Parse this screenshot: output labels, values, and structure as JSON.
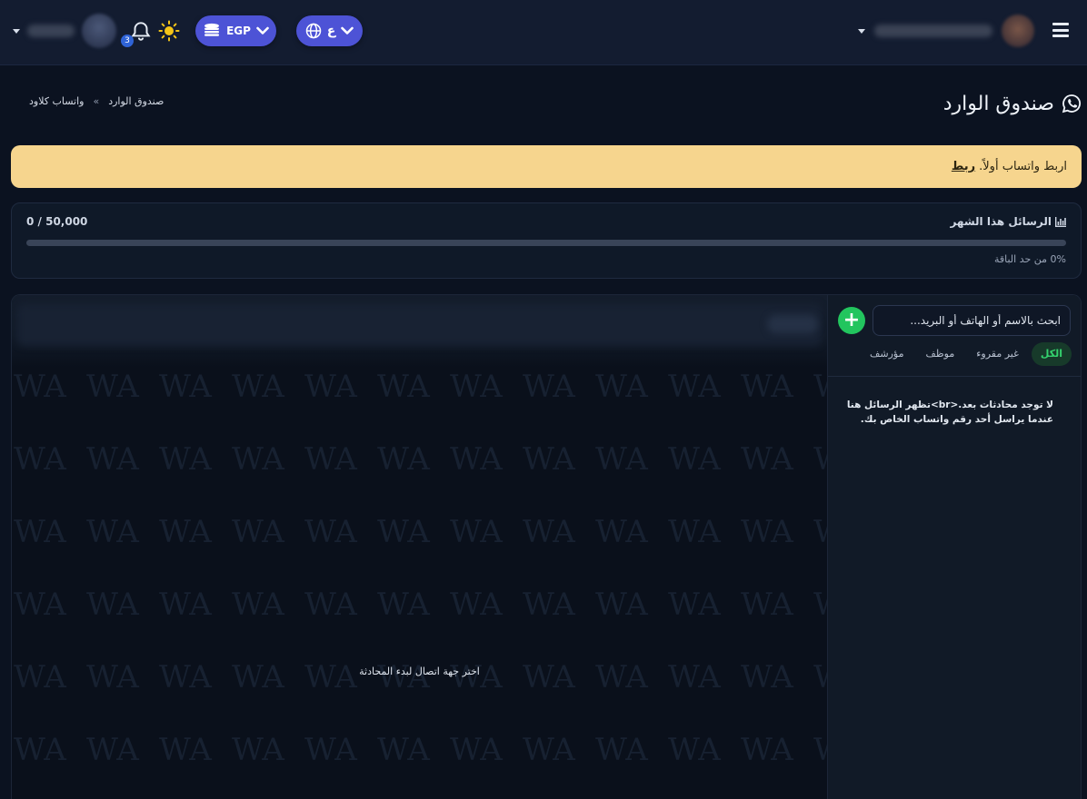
{
  "topbar": {
    "notifications_count": "3",
    "currency_label": "EGP",
    "language_label": "ع",
    "icons": {
      "user_menu_caret": "caret-down-icon",
      "notifications": "bell-icon",
      "theme_toggle": "sun-icon",
      "currency": "coins-icon",
      "language": "globe-icon",
      "menu": "hamburger-icon"
    },
    "colors": {
      "pill": "#4d53d6",
      "badge": "#2f63d6",
      "sun": "#f5c518"
    }
  },
  "page": {
    "title": "صندوق الوارد",
    "title_icon": "whatsapp-icon",
    "breadcrumb": [
      "واتساب كلاود",
      "صندوق الوارد"
    ],
    "breadcrumb_separator": "»"
  },
  "alert": {
    "text": "اربط واتساب أولاً.",
    "link_label": "ربط",
    "color": "#f6d58e"
  },
  "usage": {
    "title": "الرسائل هذا الشهر",
    "title_icon": "bar-chart-icon",
    "count": "0 / 50,000",
    "percent_text": "0% من حد الباقة",
    "progress_fraction": 0
  },
  "chat": {
    "pattern_text": "WA",
    "empty_text": "اختر جهة اتصال لبدء المحادثة"
  },
  "sidebar": {
    "add_label": "+",
    "search_placeholder": "ابحث بالاسم أو الهاتف أو البريد...",
    "tabs": [
      {
        "label": "الكل",
        "active": true
      },
      {
        "label": "غير مقروء",
        "active": false
      },
      {
        "label": "موظف",
        "active": false
      },
      {
        "label": "مؤرشف",
        "active": false
      }
    ],
    "empty_text": "لا توجد محادثات بعد.<br>تظهر الرسائل هنا عندما يراسل أحد رقم واتساب الخاص بك.",
    "accent": "#22c55e"
  }
}
